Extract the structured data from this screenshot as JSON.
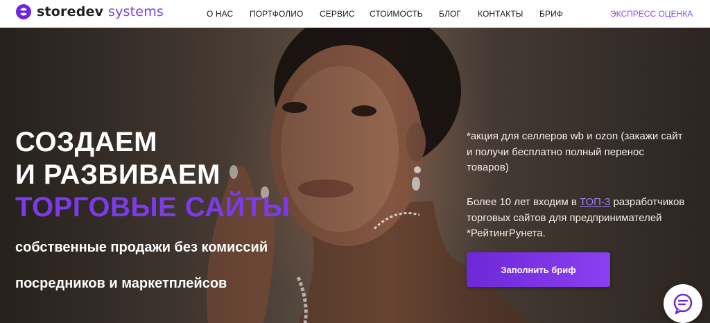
{
  "brand": {
    "name": "storedev",
    "accent_name": "systems",
    "accent_color": "#7b3fe4"
  },
  "nav": {
    "items": [
      {
        "label": "О НАС"
      },
      {
        "label": "ПОРТФОЛИО"
      },
      {
        "label": "СЕРВИС"
      },
      {
        "label": "СТОИМОСТЬ"
      },
      {
        "label": "БЛОГ"
      },
      {
        "label": "КОНТАКТЫ"
      },
      {
        "label": "БРИФ"
      }
    ],
    "express_label": "ЭКСПРЕСС ОЦЕНКА"
  },
  "hero": {
    "headline_1": "СОЗДАЕМ",
    "headline_2": "И РАЗВИВАЕМ",
    "headline_3": "ТОРГОВЫЕ САЙТЫ",
    "subline_1": "собственные продажи без комиссий",
    "subline_2": "посредников и маркетплейсов",
    "promo_text": "*акция для селлеров wb и ozon (закажи сайт и получи бесплатно полный перенос товаров)",
    "rating_before": "Более 10 лет входим в ",
    "rating_link": "ТОП-3",
    "rating_after": " разработчиков торговых сайтов для предпринимателей *РейтингРунета.",
    "cta_label": "Заполнить бриф"
  },
  "icons": {
    "logo": "logo-mark-icon",
    "chat": "chat-bubble-icon"
  },
  "colors": {
    "purple": "#7c3aed",
    "cta_gradient_start": "#6d28d9",
    "cta_gradient_end": "#8b3ff0"
  }
}
